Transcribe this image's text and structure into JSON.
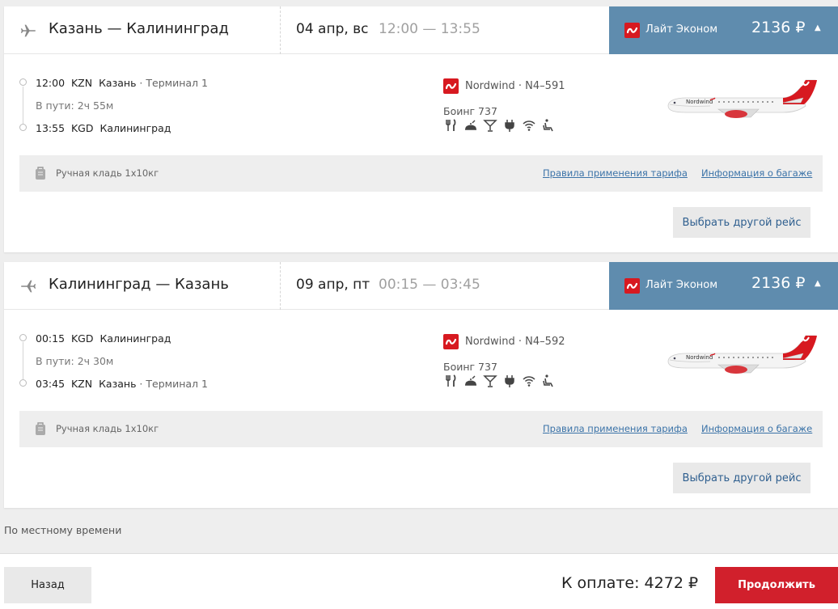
{
  "colors": {
    "fare_bar": "#5f8cae",
    "brand_red": "#d71920",
    "continue_red": "#d1202c",
    "link_blue": "#3b73a8"
  },
  "flights": [
    {
      "route": "Казань — Калининград",
      "date": "04 апр, вс",
      "times": "12:00 — 13:55",
      "fare": {
        "name": "Лайт Эконом",
        "price": "2136 ₽",
        "caret": "▲"
      },
      "dep": {
        "time": "12:00",
        "code": "KZN",
        "city": "Казань",
        "terminal": " · Терминал 1"
      },
      "duration": "В пути: 2ч 55м",
      "arr": {
        "time": "13:55",
        "code": "KGD",
        "city": "Калининград",
        "terminal": ""
      },
      "airline": "Nordwind · N4–591",
      "aircraft": "Боинг 737",
      "amenities": [
        "meal-icon",
        "hot-meal-icon",
        "drinks-icon",
        "power-outlet-icon",
        "wifi-icon",
        "seat-icon"
      ],
      "baggage": "Ручная кладь 1х10кг",
      "tariff_rules": "Правила применения тарифа",
      "baggage_info": "Информация о багаже",
      "other_flight": "Выбрать другой рейс"
    },
    {
      "route": "Калининград — Казань",
      "date": "09 апр, пт",
      "times": "00:15 — 03:45",
      "fare": {
        "name": "Лайт Эконом",
        "price": "2136 ₽",
        "caret": "▲"
      },
      "dep": {
        "time": "00:15",
        "code": "KGD",
        "city": "Калининград",
        "terminal": ""
      },
      "duration": "В пути: 2ч 30м",
      "arr": {
        "time": "03:45",
        "code": "KZN",
        "city": "Казань",
        "terminal": " · Терминал 1"
      },
      "airline": "Nordwind · N4–592",
      "aircraft": "Боинг 737",
      "amenities": [
        "meal-icon",
        "hot-meal-icon",
        "drinks-icon",
        "power-outlet-icon",
        "wifi-icon",
        "seat-icon"
      ],
      "baggage": "Ручная кладь 1х10кг",
      "tariff_rules": "Правила применения тарифа",
      "baggage_info": "Информация о багаже",
      "other_flight": "Выбрать другой рейс"
    }
  ],
  "local_time_note": "По местному времени",
  "footer": {
    "back": "Назад",
    "total": "К оплате: 4272 ₽",
    "continue": "Продолжить"
  }
}
